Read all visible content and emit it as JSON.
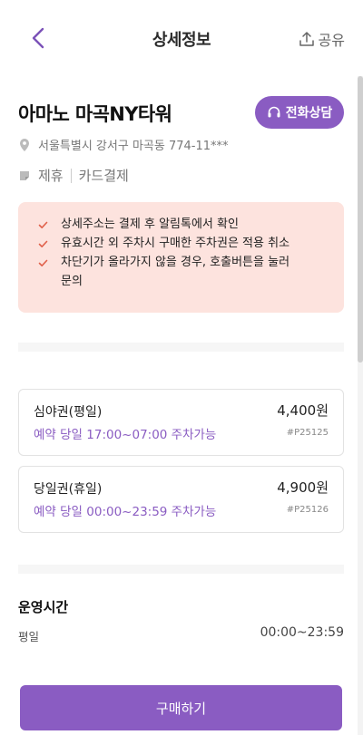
{
  "header": {
    "title": "상세정보",
    "share_label": "공유"
  },
  "place": {
    "name": "아마노 마곡NY타워",
    "call_label": "전화상담",
    "address": "서울특별시 강서구 마곡동 774-11***",
    "tags": [
      "제휴",
      "카드결제"
    ]
  },
  "notices": [
    "상세주소는 결제 후 알림톡에서 확인",
    "유효시간 외 주차시 구매한 주차권은 적용 취소",
    "차단기가 올라가지 않을 경우, 호출버튼을 눌러\n문의"
  ],
  "tickets": [
    {
      "name": "심야권(평일)",
      "price": "4,400원",
      "time": "예약 당일 17:00~07:00 주차가능",
      "code": "#P25125"
    },
    {
      "name": "당일권(휴일)",
      "price": "4,900원",
      "time": "예약 당일 00:00~23:59 주차가능",
      "code": "#P25126"
    }
  ],
  "hours": {
    "title": "운영시간",
    "day": "평일",
    "time": "00:00~23:59"
  },
  "buy_label": "구매하기",
  "colors": {
    "accent": "#8a5cc2",
    "notice_bg": "#fde3de",
    "check": "#e0604a"
  }
}
